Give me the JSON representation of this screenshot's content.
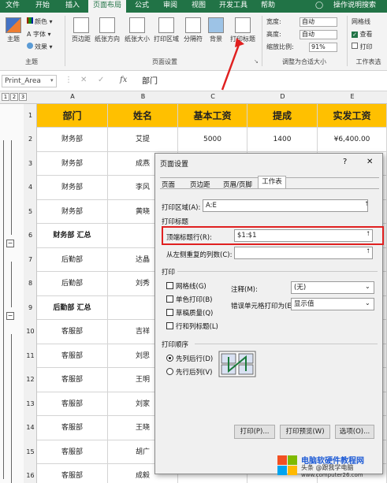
{
  "tabs": [
    "文件",
    "开始",
    "插入",
    "页面布局",
    "公式",
    "审阅",
    "视图",
    "开发工具",
    "帮助",
    "操作说明搜索"
  ],
  "ribbon": {
    "theme_group": {
      "label": "主题",
      "colors": "颜色",
      "fonts": "字体",
      "effects": "效果",
      "theme": "主题"
    },
    "page_setup_group": {
      "label": "页面设置",
      "buttons": [
        "页边距",
        "纸张方向",
        "纸张大小",
        "打印区域",
        "分隔符",
        "背景",
        "打印标题"
      ]
    },
    "fit_group": {
      "label": "调整为合适大小",
      "width_label": "宽度:",
      "width_value": "自动",
      "height_label": "高度:",
      "height_value": "自动",
      "scale_label": "缩放比例:",
      "scale_value": "91%"
    },
    "sheet_options": {
      "gridlines": "网格线",
      "view": "查看",
      "print": "打印",
      "label": "工作表选"
    }
  },
  "formula_bar": {
    "name_box": "Print_Area",
    "fx": "fx",
    "content": "部门"
  },
  "sheet": {
    "col_headers": [
      "A",
      "B",
      "C",
      "D",
      "E"
    ],
    "outline_levels": [
      "1",
      "2",
      "3"
    ],
    "header_row": [
      "部门",
      "姓名",
      "基本工资",
      "提成",
      "实发工资"
    ],
    "rows": [
      {
        "num": "2",
        "cells": [
          "财务部",
          "艾提",
          "5000",
          "1400",
          "¥6,400.00"
        ],
        "bold": false
      },
      {
        "num": "3",
        "cells": [
          "财务部",
          "成燕",
          "",
          "",
          ""
        ],
        "bold": false
      },
      {
        "num": "4",
        "cells": [
          "财务部",
          "李风",
          "",
          "",
          ""
        ],
        "bold": false
      },
      {
        "num": "5",
        "cells": [
          "财务部",
          "黄晓",
          "",
          "",
          ""
        ],
        "bold": false
      },
      {
        "num": "6",
        "cells": [
          "财务部 汇总",
          "",
          "",
          "",
          ""
        ],
        "bold": true
      },
      {
        "num": "7",
        "cells": [
          "后勤部",
          "达晶",
          "",
          "",
          ""
        ],
        "bold": false
      },
      {
        "num": "8",
        "cells": [
          "后勤部",
          "刘秀",
          "",
          "",
          ""
        ],
        "bold": false
      },
      {
        "num": "9",
        "cells": [
          "后勤部 汇总",
          "",
          "",
          "",
          ""
        ],
        "bold": true
      },
      {
        "num": "10",
        "cells": [
          "客服部",
          "吉祥",
          "",
          "",
          ""
        ],
        "bold": false
      },
      {
        "num": "11",
        "cells": [
          "客服部",
          "刘思",
          "",
          "",
          ""
        ],
        "bold": false
      },
      {
        "num": "12",
        "cells": [
          "客服部",
          "王明",
          "",
          "",
          ""
        ],
        "bold": false
      },
      {
        "num": "13",
        "cells": [
          "客服部",
          "刘家",
          "",
          "",
          ""
        ],
        "bold": false
      },
      {
        "num": "14",
        "cells": [
          "客服部",
          "王晓",
          "",
          "",
          ""
        ],
        "bold": false
      },
      {
        "num": "15",
        "cells": [
          "客服部",
          "胡广",
          "",
          "",
          ""
        ],
        "bold": false
      },
      {
        "num": "16",
        "cells": [
          "客服部",
          "成毅",
          "",
          "",
          ""
        ],
        "bold": false
      }
    ]
  },
  "dialog": {
    "title": "页面设置",
    "help": "?",
    "close": "✕",
    "tabs": [
      "页面",
      "页边距",
      "页眉/页脚",
      "工作表"
    ],
    "print_area_label": "打印区域(A):",
    "print_area_value": "A:E",
    "print_titles_section": "打印标题",
    "top_rows_label": "顶端标题行(R):",
    "top_rows_value": "$1:$1",
    "left_cols_label": "从左侧重复的列数(C):",
    "left_cols_value": "",
    "print_section": "打印",
    "checkboxes": [
      {
        "label": "网格线(G)",
        "checked": false
      },
      {
        "label": "单色打印(B)",
        "checked": false
      },
      {
        "label": "草稿质量(Q)",
        "checked": false
      },
      {
        "label": "行和列标题(L)",
        "checked": false
      }
    ],
    "comments_label": "注释(M):",
    "comments_value": "(无)",
    "errors_label": "错误单元格打印为(E):",
    "errors_value": "显示值",
    "order_section": "打印顺序",
    "order_options": [
      {
        "label": "先列后行(D)",
        "selected": true
      },
      {
        "label": "先行后列(V)",
        "selected": false
      }
    ],
    "buttons": {
      "print": "打印(P)...",
      "preview": "打印预览(W)",
      "options": "选项(O)..."
    }
  },
  "watermark": {
    "text": "电脑软硬件教程网",
    "sub": "头条 @跟我学电脑",
    "url": "www.computer26.com"
  },
  "colors": {
    "excel_green": "#217346",
    "header_fill": "#ffc000",
    "highlight_red": "#e02020"
  }
}
